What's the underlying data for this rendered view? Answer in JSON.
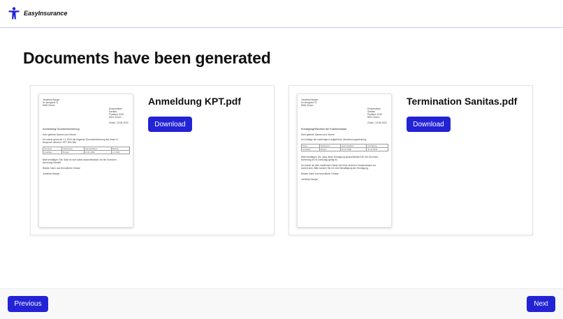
{
  "header": {
    "brand": "EasyInsurance",
    "logo_icon": "person-figure-icon",
    "accent_color": "#2323d6"
  },
  "main": {
    "title": "Documents have been generated"
  },
  "documents": [
    {
      "filename": "Anmeldung KPT.pdf",
      "download_label": "Download",
      "preview": {
        "sender": [
          "Jonathan Burger",
          "Im Isengrind 11",
          "8046 Zürich"
        ],
        "recipient": [
          "Einschreiben",
          "Sanitas",
          "Postfach 2010",
          "8021 Zürich"
        ],
        "date": "Zürich, 19.06.2023",
        "subject": "Anmeldung Grundversicherung",
        "salutation": "Sehr geehrte Damen und Herren",
        "body": [
          "Ich würde gerne ab 1.1.2024 die folgende Grundversicherung bei Ihnen in",
          "Anspruch nehmen: KPT Win Win"
        ],
        "table": [
          [
            "Vorname",
            "Nachname",
            "Geburtsdatum",
            "Beitrag"
          ],
          [
            "Jonathan",
            "Burger",
            "01.01.1990",
            "1.1.2024"
          ]
        ],
        "closing_text": [
          "Bitte bestätigen Sie, dass es sich dabei ausschliesslich um die Grundver-",
          "sicherung handelt."
        ],
        "closing": "Besten Dank und freundliche Grüsse",
        "signature": "Jonathan Burger"
      }
    },
    {
      "filename": "Termination Sanitas.pdf",
      "download_label": "Download",
      "preview": {
        "sender": [
          "Jonathan Burger",
          "Im Isengrind 11",
          "8046 Zürich"
        ],
        "recipient": [
          "Einschreiben",
          "Sanitas",
          "Postfach 2010",
          "8021 Zürich"
        ],
        "date": "Zürich, 19.06.2023",
        "subject": "Kündigung/Wechsel der Krankenkasse",
        "salutation": "Sehr geehrte Damen und Herren",
        "body": [
          "Ich kündige die nachfolgend aufgeführte Versicherungsdeckung:"
        ],
        "table": [
          [
            "Name",
            "Nachname",
            "Geburtsdatum",
            "Kündigung"
          ],
          [
            "Jonathan",
            "Burger",
            "01.01.1990",
            "31.12.2023"
          ]
        ],
        "closing_text": [
          "Bitte bestätigen Sie, dass diese Kündigung ausschliesslich für die Grundver-",
          "sicherung (KVG-Deckung) gültig ist.",
          "",
          "Ich werde ab dem erwähnten Datum bei einer anderen Krankenkasse ver-",
          "sichert sein. Bitte senden Sie mir eine Bestätigung der Kündigung."
        ],
        "closing": "Besten Dank und freundliche Grüsse",
        "signature": "Jonathan Burger"
      }
    }
  ],
  "footer": {
    "previous_label": "Previous",
    "next_label": "Next"
  }
}
